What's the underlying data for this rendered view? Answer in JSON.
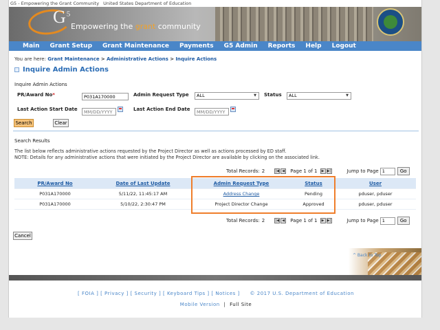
{
  "header": {
    "img_alt_left": "G5 - Empowering the Grant Community",
    "img_alt_right": "United States Department of Education",
    "logo_text": "G",
    "logo_sup": "5",
    "tagline_prefix": "Empowering the ",
    "tagline_highlight": "grant",
    "tagline_suffix": " community"
  },
  "nav": [
    "Main",
    "Grant Setup",
    "Grant Maintenance",
    "Payments",
    "G5 Admin",
    "Reports",
    "Help",
    "Logout"
  ],
  "breadcrumb": {
    "prefix": "You are here:",
    "items": [
      "Grant Maintenance",
      "Administrative Actions",
      "Inquire Actions"
    ],
    "separator": ">"
  },
  "page_title": "Inquire Admin Actions",
  "form": {
    "section_label": "Inquire Admin Actions",
    "award_label": "PR/Award No",
    "award_required": "*",
    "award_value": "P031A170000",
    "request_type_label": "Admin Request Type",
    "request_type_value": "ALL",
    "status_label": "Status",
    "status_value": "ALL",
    "start_date_label": "Last Action Start Date",
    "start_date_placeholder": "MM/DD/YYYY",
    "end_date_label": "Last Action End Date",
    "end_date_placeholder": "MM/DD/YYYY",
    "search_button": "Search",
    "clear_button": "Clear"
  },
  "results": {
    "section_label": "Search Results",
    "note_line1": "The list below reflects administrative actions requested by the Project Director as well as actions processed by ED staff.",
    "note_line2": "NOTE: Details for any administrative actions that were initiated by the Project Director are available by clicking on the associated link.",
    "total_records_label": "Total Records:",
    "total_records": "2",
    "page_label": "Page 1 of 1",
    "jump_label": "Jump to Page",
    "jump_value": "1",
    "go_button": "Go",
    "columns": [
      "PR/Award No",
      "Date of Last Update",
      "Admin Request Type",
      "Status",
      "User"
    ],
    "rows": [
      {
        "award": "P031A170000",
        "date": "5/11/22, 11:45:17 AM",
        "type": "Address Change",
        "status": "Pending",
        "user": "pduser, pduser"
      },
      {
        "award": "P031A170000",
        "date": "5/10/22, 2:30:47 PM",
        "type": "Project Director Change",
        "status": "Approved",
        "user": "pduser, pduser"
      }
    ]
  },
  "cancel_button": "Cancel",
  "back_to_top": "^ Back to Top",
  "footer": {
    "links": [
      "FOIA",
      "Privacy",
      "Security",
      "Keyboard Tips",
      "Notices"
    ],
    "copyright": "© 2017 U.S. Department of Education",
    "mobile_version": "Mobile Version",
    "divider": "|",
    "full_site": "Full Site"
  },
  "colors": {
    "nav_bg": "#4a86c8",
    "link": "#1d5aa3",
    "highlight_border": "#ef7d2a",
    "search_button": "#f6c37a",
    "grid_header": "#dce8f6"
  },
  "icons": [
    "calendar-icon",
    "first-page-icon",
    "prev-page-icon",
    "next-page-icon",
    "last-page-icon",
    "ed-seal-logo"
  ]
}
